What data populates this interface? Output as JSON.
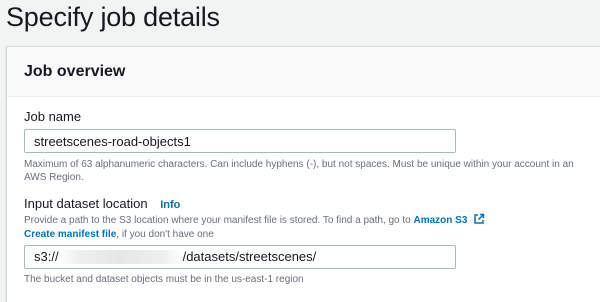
{
  "page": {
    "title": "Specify job details"
  },
  "panel": {
    "title": "Job overview"
  },
  "job_name": {
    "label": "Job name",
    "value": "streetscenes-road-objects1",
    "hint": "Maximum of 63 alphanumeric characters. Can include hyphens (-), but not spaces. Must be unique within your account in an AWS Region."
  },
  "dataset": {
    "label": "Input dataset location",
    "info": "Info",
    "hint_prefix": "Provide a path to the S3 location where your manifest file is stored. To find a path, go to",
    "amazon_s3_link": "Amazon S3",
    "create_manifest_link": "Create manifest file",
    "create_manifest_suffix": ", if you don't have one",
    "value_prefix": "s3://",
    "value_suffix": "/datasets/streetscenes/",
    "region_hint": "The bucket and dataset objects must be in the us-east-1 region"
  },
  "icons": {
    "external_link": "external-link-icon"
  },
  "colors": {
    "link": "#0073bb",
    "border": "#aab7b8",
    "background": "#f2f3f3",
    "hint": "#687078"
  }
}
